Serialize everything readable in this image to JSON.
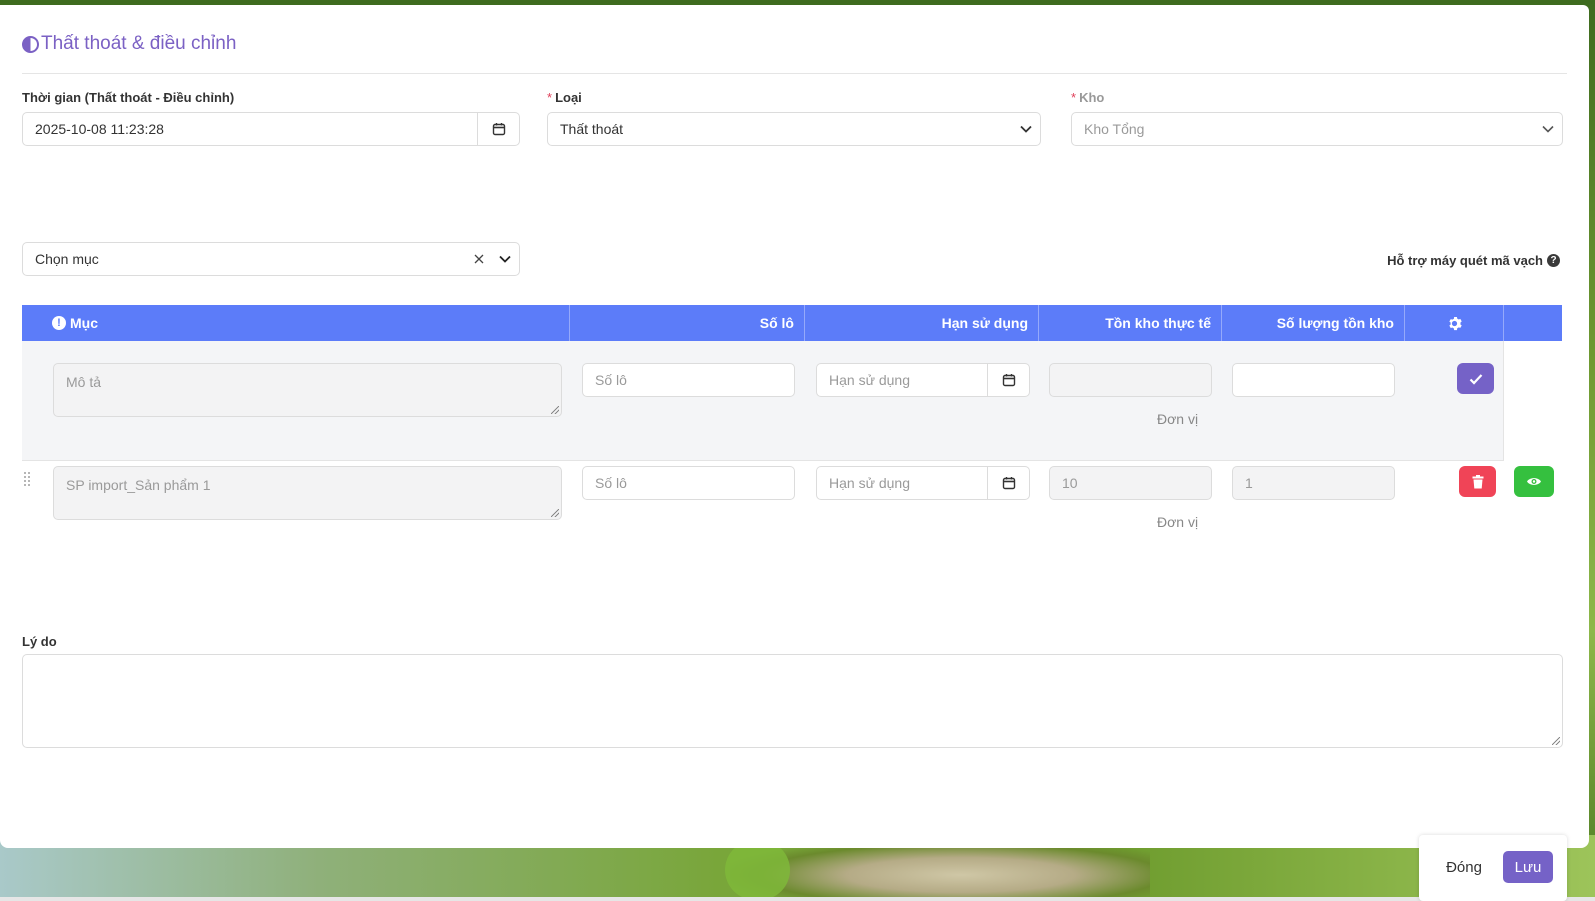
{
  "modal": {
    "title": "Thất thoát & điều chỉnh"
  },
  "form": {
    "time_label": "Thời gian (Thất thoát - Điều chỉnh)",
    "time_value": "2025-10-08 11:23:28",
    "type_label": "Loại",
    "type_value": "Thất thoát",
    "warehouse_label": "Kho",
    "warehouse_value": "Kho Tổng",
    "required_mark": "*"
  },
  "item_picker": {
    "value": "Chọn mục"
  },
  "scanner_help": {
    "label": "Hỗ trợ máy quét mã vạch",
    "icon": "question-circle-icon"
  },
  "table": {
    "columns": [
      "Mục",
      "Số lô",
      "Hạn sử dụng",
      "Tồn kho thực tế",
      "Số lượng tồn kho"
    ],
    "header_color": "#5c7cf9",
    "new_row": {
      "desc_placeholder": "Mô tả",
      "lot_placeholder": "Số lô",
      "expiry_placeholder": "Hạn sử dụng",
      "actual_stock": "",
      "quantity": "",
      "unit": "Đơn vị"
    },
    "rows": [
      {
        "item": "SP import_Sản phẩm 1",
        "lot_placeholder": "Số lô",
        "expiry_placeholder": "Hạn sử dụng",
        "actual_stock": "10",
        "quantity": "1",
        "unit": "Đơn vị"
      }
    ]
  },
  "reason": {
    "label": "Lý do",
    "value": ""
  },
  "footer": {
    "close_label": "Đóng",
    "save_label": "Lưu"
  },
  "colors": {
    "accent": "#7562c7",
    "delete": "#f04457",
    "view": "#35c03f",
    "title": "#7b61c4"
  }
}
